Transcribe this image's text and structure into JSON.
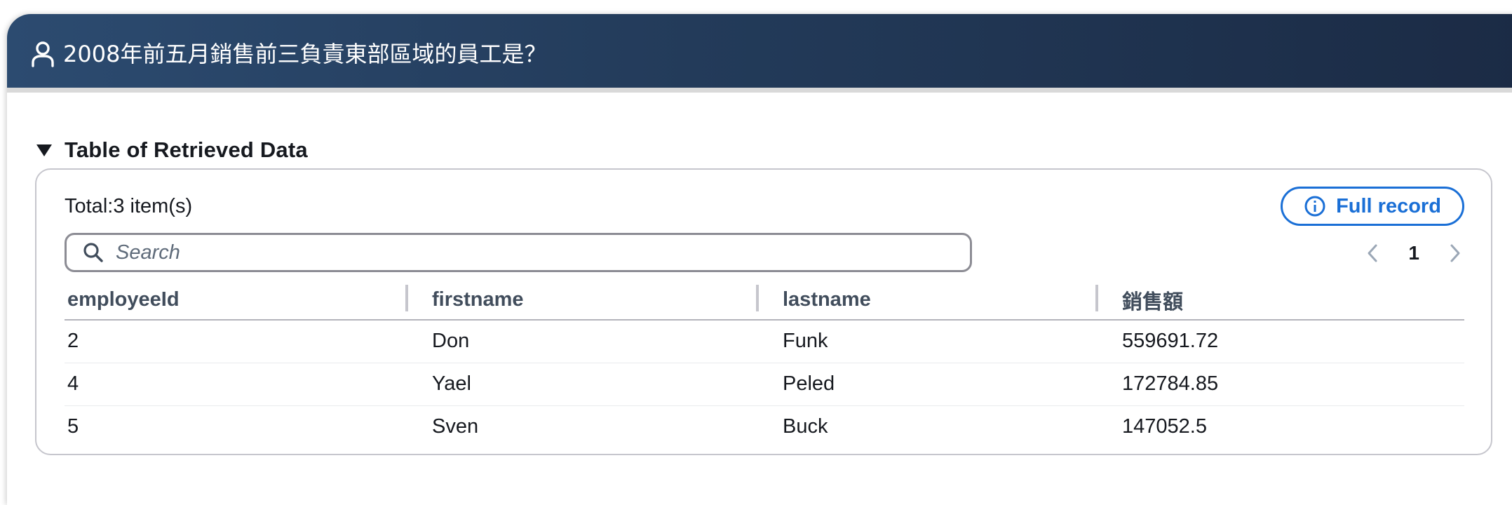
{
  "header": {
    "question": "2008年前五月銷售前三負責東部區域的員工是？",
    "icon": "user-icon"
  },
  "section": {
    "title": "Table of Retrieved Data",
    "expanded": true
  },
  "panel": {
    "total_label": "Total:3 item(s)",
    "full_record_label": "Full record",
    "search_placeholder": "Search",
    "search_value": "",
    "current_page": "1"
  },
  "table": {
    "columns": [
      "employeeId",
      "firstname",
      "lastname",
      "銷售額"
    ],
    "rows": [
      [
        "2",
        "Don",
        "Funk",
        "559691.72"
      ],
      [
        "4",
        "Yael",
        "Peled",
        "172784.85"
      ],
      [
        "5",
        "Sven",
        "Buck",
        "147052.5"
      ]
    ]
  },
  "colors": {
    "header_start": "#2c4b70",
    "header_end": "#1b2b45",
    "accent": "#1a6fd6"
  }
}
